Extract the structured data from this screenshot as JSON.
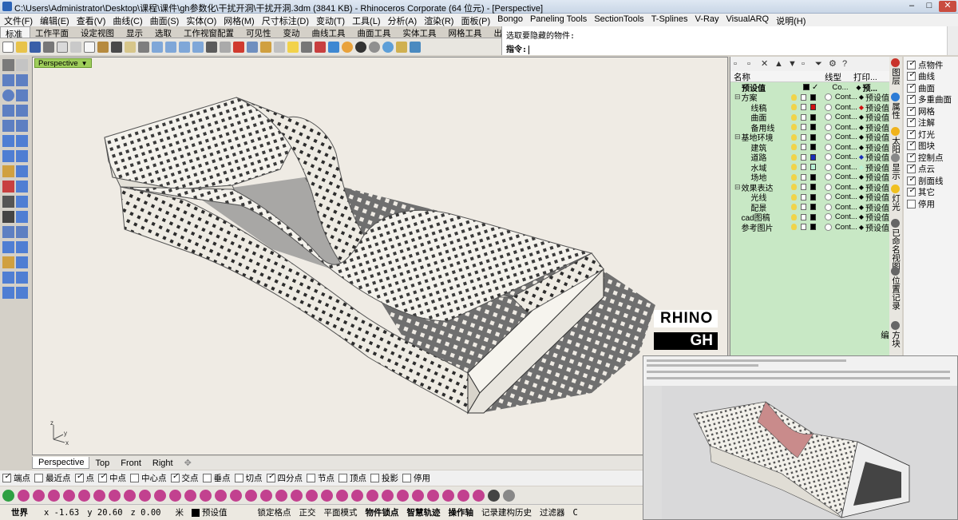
{
  "window": {
    "title": "C:\\Users\\Administrator\\Desktop\\课程\\课件\\gh参数化\\干扰开洞\\干扰开洞.3dm (3841 KB) - Rhinoceros Corporate (64 位元) - [Perspective]",
    "min": "–",
    "max": "□",
    "close": "✕"
  },
  "menu": [
    "文件(F)",
    "编辑(E)",
    "查看(V)",
    "曲线(C)",
    "曲面(S)",
    "实体(O)",
    "网格(M)",
    "尺寸标注(D)",
    "变动(T)",
    "工具(L)",
    "分析(A)",
    "渲染(R)",
    "面板(P)",
    "Bongo",
    "Paneling Tools",
    "SectionTools",
    "T-Splines",
    "V-Ray",
    "VisualARQ",
    "说明(H)"
  ],
  "tabs": [
    "标准",
    "工作平面",
    "设定视图",
    "显示",
    "选取",
    "工作视窗配置",
    "可见性",
    "变动",
    "曲线工具",
    "曲面工具",
    "实体工具",
    "网格工具",
    "出图"
  ],
  "command": {
    "history": "选取要隐藏的物件:",
    "prompt": "指令:"
  },
  "viewport": {
    "label": "Perspective",
    "tabs": [
      "Perspective",
      "Top",
      "Front",
      "Right"
    ],
    "add_tab": "✥",
    "watermark_top": "RHINO",
    "watermark_bottom": "GH",
    "axis_z": "z",
    "axis_y": "y",
    "axis_x": "x"
  },
  "osnaps": [
    {
      "label": "端点",
      "on": true
    },
    {
      "label": "最近点",
      "on": false
    },
    {
      "label": "点",
      "on": true
    },
    {
      "label": "中点",
      "on": true
    },
    {
      "label": "中心点",
      "on": false
    },
    {
      "label": "交点",
      "on": true
    },
    {
      "label": "垂点",
      "on": false
    },
    {
      "label": "切点",
      "on": false
    },
    {
      "label": "四分点",
      "on": true
    },
    {
      "label": "节点",
      "on": false
    },
    {
      "label": "顶点",
      "on": false
    },
    {
      "label": "投影",
      "on": false
    },
    {
      "label": "停用",
      "on": false
    }
  ],
  "status": {
    "cplane": "世界",
    "x": "x -1.63",
    "y": "y 20.60",
    "z": "z 0.00",
    "unit": "米",
    "layer": "预设值",
    "grid_snap": "锁定格点",
    "ortho": "正交",
    "planar": "平面模式",
    "osnap": "物件锁点",
    "smarttrack": "智慧轨迹",
    "gumball": "操作轴",
    "history": "记录建构历史",
    "filter": "过滤器",
    "tail": "C"
  },
  "layers": {
    "header_name": "名称",
    "header_linetype": "线型",
    "header_print": "打印...",
    "rows": [
      {
        "indent": 0,
        "exp": "",
        "name": "预设值",
        "bold": true,
        "color": "#000000",
        "check": "✓",
        "lt": "Co...",
        "pc": "#000000",
        "pw": "预..."
      },
      {
        "indent": 0,
        "exp": "⊟",
        "name": "方案",
        "color": "#000000",
        "lt": "Cont...",
        "pc": "#000000",
        "pw": "预设值"
      },
      {
        "indent": 1,
        "exp": "",
        "name": "线稿",
        "color": "#d01010",
        "lt": "Cont...",
        "pc": "#d01010",
        "pw": "预设值"
      },
      {
        "indent": 1,
        "exp": "",
        "name": "曲面",
        "color": "#000000",
        "lt": "Cont...",
        "pc": "#000000",
        "pw": "预设值"
      },
      {
        "indent": 1,
        "exp": "",
        "name": "备用线",
        "color": "#000000",
        "lt": "Cont...",
        "pc": "#000000",
        "pw": "预设值"
      },
      {
        "indent": 0,
        "exp": "⊟",
        "name": "基地环境",
        "color": "#000000",
        "lt": "Cont...",
        "pc": "#000000",
        "pw": "预设值"
      },
      {
        "indent": 1,
        "exp": "",
        "name": "建筑",
        "color": "#000000",
        "lt": "Cont...",
        "pc": "#000000",
        "pw": "预设值"
      },
      {
        "indent": 1,
        "exp": "",
        "name": "道路",
        "color": "#1a2fb8",
        "lt": "Cont...",
        "pc": "#1a2fb8",
        "pw": "预设值"
      },
      {
        "indent": 1,
        "exp": "",
        "name": "水域",
        "color": "#b8f0d4",
        "lt": "Cont...",
        "pc": "#b8f0d4",
        "pw": "预设值"
      },
      {
        "indent": 1,
        "exp": "",
        "name": "场地",
        "color": "#000000",
        "lt": "Cont...",
        "pc": "#000000",
        "pw": "预设值"
      },
      {
        "indent": 0,
        "exp": "⊟",
        "name": "效果表达",
        "color": "#000000",
        "lt": "Cont...",
        "pc": "#000000",
        "pw": "预设值"
      },
      {
        "indent": 1,
        "exp": "",
        "name": "光线",
        "color": "#000000",
        "lt": "Cont...",
        "pc": "#000000",
        "pw": "预设值"
      },
      {
        "indent": 1,
        "exp": "",
        "name": "配景",
        "color": "#000000",
        "lt": "Cont...",
        "pc": "#000000",
        "pw": "预设值"
      },
      {
        "indent": 0,
        "exp": "",
        "name": "cad图稿",
        "color": "#000000",
        "lt": "Cont...",
        "pc": "#000000",
        "pw": "预设值"
      },
      {
        "indent": 0,
        "exp": "",
        "name": "参考图片",
        "color": "#000000",
        "lt": "Cont...",
        "pc": "#000000",
        "pw": "预设值"
      }
    ]
  },
  "side_tabs": [
    {
      "label": "图层",
      "icon_color": "#c9332b"
    },
    {
      "label": "属性",
      "icon_color": "#2d7bd6"
    },
    {
      "label": "太阳",
      "icon_color": "#f0b21a"
    },
    {
      "label": "显示",
      "icon_color": "#888888"
    },
    {
      "label": "灯光",
      "icon_color": "#f0c020"
    },
    {
      "label": "已命名视图",
      "icon_color": "#666666"
    },
    {
      "label": "位置记录",
      "icon_color": "#666666"
    },
    {
      "label": "方块编",
      "icon_color": "#666666"
    }
  ],
  "filters": [
    {
      "label": "点物件",
      "on": true
    },
    {
      "label": "曲线",
      "on": true
    },
    {
      "label": "曲面",
      "on": true
    },
    {
      "label": "多重曲面",
      "on": true
    },
    {
      "label": "网格",
      "on": true
    },
    {
      "label": "注解",
      "on": true
    },
    {
      "label": "灯光",
      "on": true
    },
    {
      "label": "图块",
      "on": true
    },
    {
      "label": "控制点",
      "on": true
    },
    {
      "label": "点云",
      "on": true
    },
    {
      "label": "剖面线",
      "on": true
    },
    {
      "label": "其它",
      "on": true
    },
    {
      "label": "停用",
      "on": false
    }
  ],
  "colors": {
    "viewport_bg": "#efebe4",
    "layer_panel_bg": "#c8e8c5",
    "viewport_label_bg": "#9fce5b",
    "model_fill": "#f4f2ec",
    "model_shadow": "#6f6f6f"
  }
}
